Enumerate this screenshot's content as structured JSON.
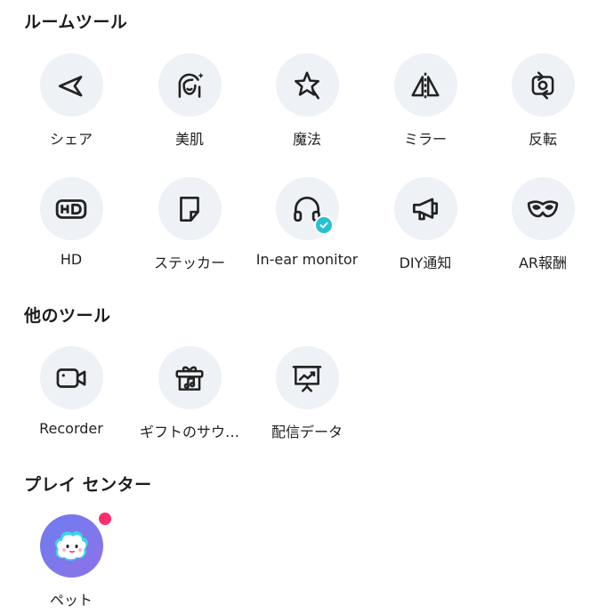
{
  "sections": {
    "room_tools": {
      "title": "ルームツール",
      "items": [
        {
          "label": "シェア",
          "icon": "share-icon"
        },
        {
          "label": "美肌",
          "icon": "beauty-face-icon"
        },
        {
          "label": "魔法",
          "icon": "magic-star-icon"
        },
        {
          "label": "ミラー",
          "icon": "mirror-icon"
        },
        {
          "label": "反転",
          "icon": "flip-camera-icon"
        },
        {
          "label": "HD",
          "icon": "hd-icon"
        },
        {
          "label": "ステッカー",
          "icon": "sticker-icon"
        },
        {
          "label": "In-ear monitor",
          "icon": "headphones-icon",
          "active": true
        },
        {
          "label": "DIY通知",
          "icon": "megaphone-icon"
        },
        {
          "label": "AR報酬",
          "icon": "mask-icon"
        }
      ]
    },
    "other_tools": {
      "title": "他のツール",
      "items": [
        {
          "label": "Recorder",
          "icon": "video-camera-icon"
        },
        {
          "label": "ギフトのサウ…",
          "icon": "gift-music-icon"
        },
        {
          "label": "配信データ",
          "icon": "chart-board-icon"
        }
      ]
    },
    "play_center": {
      "title": "プレイ センター",
      "items": [
        {
          "label": "ペット",
          "icon": "pet-icon",
          "has_notification": true
        }
      ]
    }
  },
  "colors": {
    "icon_bg": "#eef1f5",
    "check_badge": "#27c1d6",
    "notification_dot": "#ff2e6e",
    "pet_bg": "#7a77ee"
  }
}
